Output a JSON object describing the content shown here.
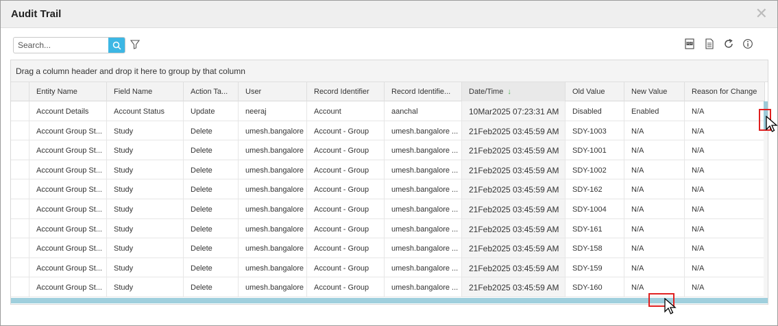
{
  "dialog": {
    "title": "Audit Trail",
    "close_symbol": "✕"
  },
  "toolbar": {
    "search_placeholder": "Search...",
    "search_value": "",
    "icons": [
      "pdf-icon",
      "excel-icon",
      "refresh-icon",
      "info-icon"
    ]
  },
  "grid": {
    "group_hint": "Drag a column header and drop it here to group by that column",
    "columns": [
      "Entity Name",
      "Field Name",
      "Action Ta...",
      "User",
      "Record Identifier",
      "Record Identifie...",
      "Date/Time",
      "Old Value",
      "New Value",
      "Reason for Change"
    ],
    "sort_indicator": "↓",
    "rows": [
      [
        "Account Details",
        "Account Status",
        "Update",
        "neeraj",
        "Account",
        "aanchal",
        "10Mar2025 07:23:31 AM",
        "Disabled",
        "Enabled",
        "N/A"
      ],
      [
        "Account Group St...",
        "Study",
        "Delete",
        "umesh.bangalore",
        "Account - Group",
        "umesh.bangalore ...",
        "21Feb2025 03:45:59 AM",
        "SDY-1003",
        "N/A",
        "N/A"
      ],
      [
        "Account Group St...",
        "Study",
        "Delete",
        "umesh.bangalore",
        "Account - Group",
        "umesh.bangalore ...",
        "21Feb2025 03:45:59 AM",
        "SDY-1001",
        "N/A",
        "N/A"
      ],
      [
        "Account Group St...",
        "Study",
        "Delete",
        "umesh.bangalore",
        "Account - Group",
        "umesh.bangalore ...",
        "21Feb2025 03:45:59 AM",
        "SDY-1002",
        "N/A",
        "N/A"
      ],
      [
        "Account Group St...",
        "Study",
        "Delete",
        "umesh.bangalore",
        "Account - Group",
        "umesh.bangalore ...",
        "21Feb2025 03:45:59 AM",
        "SDY-162",
        "N/A",
        "N/A"
      ],
      [
        "Account Group St...",
        "Study",
        "Delete",
        "umesh.bangalore",
        "Account - Group",
        "umesh.bangalore ...",
        "21Feb2025 03:45:59 AM",
        "SDY-1004",
        "N/A",
        "N/A"
      ],
      [
        "Account Group St...",
        "Study",
        "Delete",
        "umesh.bangalore",
        "Account - Group",
        "umesh.bangalore ...",
        "21Feb2025 03:45:59 AM",
        "SDY-161",
        "N/A",
        "N/A"
      ],
      [
        "Account Group St...",
        "Study",
        "Delete",
        "umesh.bangalore",
        "Account - Group",
        "umesh.bangalore ...",
        "21Feb2025 03:45:59 AM",
        "SDY-158",
        "N/A",
        "N/A"
      ],
      [
        "Account Group St...",
        "Study",
        "Delete",
        "umesh.bangalore",
        "Account - Group",
        "umesh.bangalore ...",
        "21Feb2025 03:45:59 AM",
        "SDY-159",
        "N/A",
        "N/A"
      ],
      [
        "Account Group St...",
        "Study",
        "Delete",
        "umesh.bangalore",
        "Account - Group",
        "umesh.bangalore ...",
        "21Feb2025 03:45:59 AM",
        "SDY-160",
        "N/A",
        "N/A"
      ]
    ]
  },
  "colors": {
    "accent": "#3db7e4",
    "scrollbar": "#9fcfdd",
    "sort_arrow": "#4caf50",
    "highlight_box": "#e02020"
  }
}
